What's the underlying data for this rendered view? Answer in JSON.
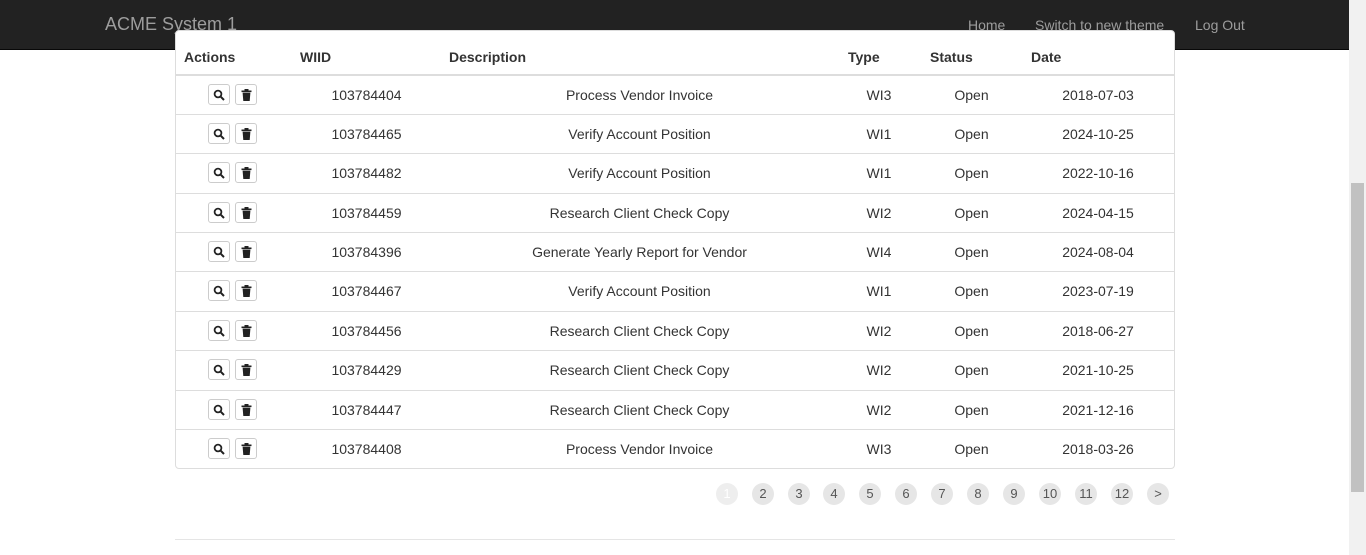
{
  "navbar": {
    "brand": "ACME System 1",
    "links": [
      "Home",
      "Switch to new theme",
      "Log Out"
    ]
  },
  "table": {
    "headers": [
      "Actions",
      "WIID",
      "Description",
      "Type",
      "Status",
      "Date"
    ],
    "rows": [
      {
        "wiid": "103784404",
        "description": "Process Vendor Invoice",
        "type": "WI3",
        "status": "Open",
        "date": "2018-07-03"
      },
      {
        "wiid": "103784465",
        "description": "Verify Account Position",
        "type": "WI1",
        "status": "Open",
        "date": "2024-10-25"
      },
      {
        "wiid": "103784482",
        "description": "Verify Account Position",
        "type": "WI1",
        "status": "Open",
        "date": "2022-10-16"
      },
      {
        "wiid": "103784459",
        "description": "Research Client Check Copy",
        "type": "WI2",
        "status": "Open",
        "date": "2024-04-15"
      },
      {
        "wiid": "103784396",
        "description": "Generate Yearly Report for Vendor",
        "type": "WI4",
        "status": "Open",
        "date": "2024-08-04"
      },
      {
        "wiid": "103784467",
        "description": "Verify Account Position",
        "type": "WI1",
        "status": "Open",
        "date": "2023-07-19"
      },
      {
        "wiid": "103784456",
        "description": "Research Client Check Copy",
        "type": "WI2",
        "status": "Open",
        "date": "2018-06-27"
      },
      {
        "wiid": "103784429",
        "description": "Research Client Check Copy",
        "type": "WI2",
        "status": "Open",
        "date": "2021-10-25"
      },
      {
        "wiid": "103784447",
        "description": "Research Client Check Copy",
        "type": "WI2",
        "status": "Open",
        "date": "2021-12-16"
      },
      {
        "wiid": "103784408",
        "description": "Process Vendor Invoice",
        "type": "WI3",
        "status": "Open",
        "date": "2018-03-26"
      }
    ],
    "row_actions": [
      {
        "icon": "search-icon"
      },
      {
        "icon": "trash-icon"
      }
    ]
  },
  "pagination": {
    "pages": [
      "1",
      "2",
      "3",
      "4",
      "5",
      "6",
      "7",
      "8",
      "9",
      "10",
      "11",
      "12"
    ],
    "current": "1",
    "next": ">"
  },
  "colors": {
    "navbar_bg": "#222222",
    "navbar_text": "#9d9d9d",
    "border": "#dddddd",
    "page_bg": "#e6e6e6"
  }
}
